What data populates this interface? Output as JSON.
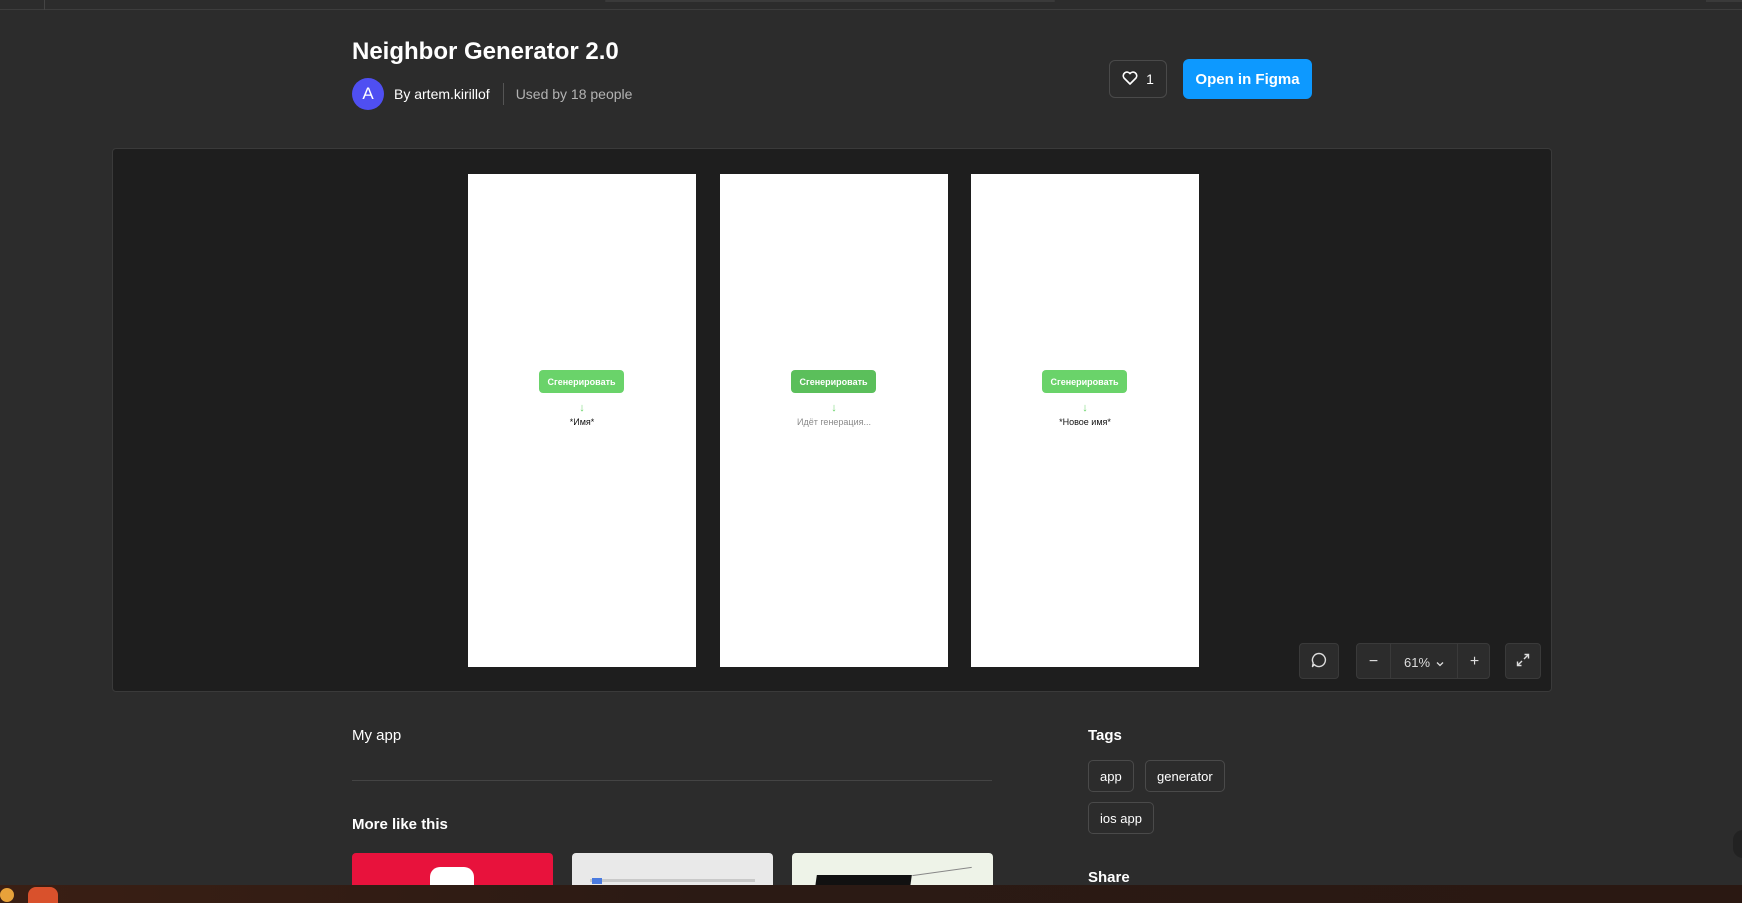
{
  "header": {
    "title": "Neighbor Generator 2.0",
    "avatar_letter": "A",
    "byline": "By artem.kirillof",
    "used_by": "Used by 18 people",
    "like_count": "1",
    "open_button": "Open in Figma"
  },
  "canvas": {
    "frames": [
      {
        "button": "Сгенерировать",
        "arrow": "↓",
        "result": "*Имя*"
      },
      {
        "button": "Сгенерировать",
        "arrow": "↓",
        "result": "Идёт генерация..."
      },
      {
        "button": "Сгенерировать",
        "arrow": "↓",
        "result": "*Новое имя*"
      }
    ],
    "zoom_level": "61%",
    "zoom_minus": "−",
    "zoom_plus": "+"
  },
  "description": "My app",
  "more_like_this": "More like this",
  "tags": {
    "heading": "Tags",
    "items": [
      "app",
      "generator",
      "ios app"
    ]
  },
  "share_heading": "Share",
  "colors": {
    "accent": "#0d99ff",
    "avatar": "#4f4ff2",
    "generate_button": "#6ad36a",
    "background": "#2c2c2c",
    "canvas": "#1e1e1e"
  }
}
